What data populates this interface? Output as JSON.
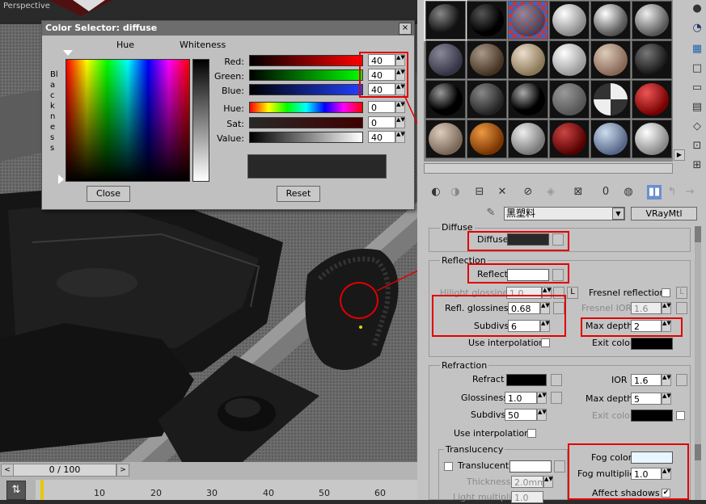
{
  "viewport": {
    "label": "Perspective"
  },
  "timeline": {
    "position": "0 / 100",
    "ticks": [
      "10",
      "20",
      "30",
      "40",
      "50",
      "60"
    ]
  },
  "color_selector": {
    "title": "Color Selector: diffuse",
    "hue_label": "Hue",
    "whiteness_label": "Whiteness",
    "blackness_label": "Blackness",
    "close_icon": "×",
    "rows": [
      {
        "label": "Red:",
        "value": "40"
      },
      {
        "label": "Green:",
        "value": "40"
      },
      {
        "label": "Blue:",
        "value": "40"
      },
      {
        "label": "Hue:",
        "value": "0"
      },
      {
        "label": "Sat:",
        "value": "0"
      },
      {
        "label": "Value:",
        "value": "40"
      }
    ],
    "close_button": "Close",
    "reset_button": "Reset"
  },
  "material_editor": {
    "material_name": "黑塑料",
    "material_type": "VRayMtl",
    "toolbar_num": "0",
    "diffuse": {
      "section": "Diffuse",
      "label": "Diffuse",
      "color": "#282828"
    },
    "reflection": {
      "section": "Reflection",
      "reflect_label": "Reflect",
      "reflect_color": "#ffffff",
      "hilight_label": "Hilight glossiness",
      "hilight_value": "1.0",
      "hilight_lock": "L",
      "fresnel_label": "Fresnel reflections",
      "fresnel_lock": "L",
      "fresnel_ior_label": "Fresnel IOR",
      "fresnel_ior_value": "1.6",
      "refl_gloss_label": "Refl. glossiness",
      "refl_gloss_value": "0.68",
      "subdivs_label": "Subdivs",
      "subdivs_value": "6",
      "max_depth_label": "Max depth",
      "max_depth_value": "2",
      "use_interp_label": "Use interpolation",
      "exit_color_label": "Exit color"
    },
    "refraction": {
      "section": "Refraction",
      "refract_label": "Refract",
      "ior_label": "IOR",
      "ior_value": "1.6",
      "gloss_label": "Glossiness",
      "gloss_value": "1.0",
      "max_depth_label": "Max depth",
      "max_depth_value": "5",
      "subdivs_label": "Subdivs",
      "subdivs_value": "50",
      "exit_color_label": "Exit color",
      "use_interp_label": "Use interpolation",
      "fog_color_label": "Fog color",
      "fog_color": "#e8f6ff",
      "fog_mult_label": "Fog multiplier",
      "fog_mult_value": "1.0",
      "affect_shadows_label": "Affect shadows",
      "affect_shadows_check": "✔"
    },
    "translucency": {
      "section": "Translucency",
      "translucent_label": "Translucent",
      "thickness_label": "Thickness",
      "thickness_value": "2.0mm",
      "light_mult_label": "Light multiplier",
      "light_mult_value": "1.0"
    }
  }
}
